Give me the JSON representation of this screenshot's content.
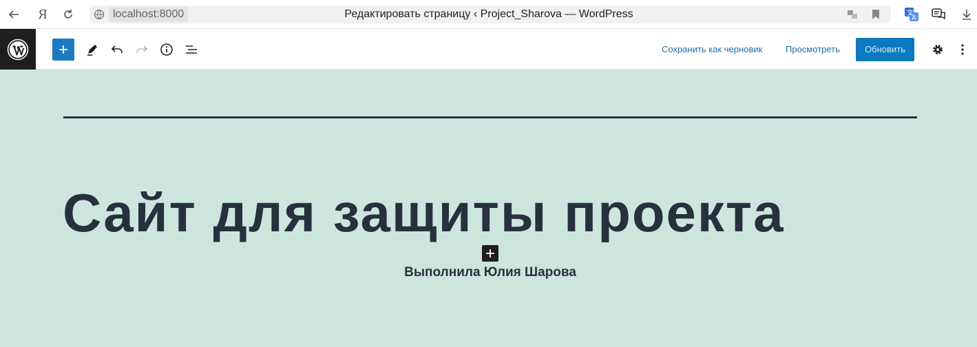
{
  "browser": {
    "url": "localhost:8000",
    "tab_title": "Редактировать страницу ‹ Project_Sharova — WordPress"
  },
  "toolbar": {
    "save_draft_label": "Сохранить как черновик",
    "preview_label": "Просмотреть",
    "update_label": "Обновить"
  },
  "content": {
    "title": "Сайт для защиты проекта",
    "author_line": "Выполнила Юлия Шарова"
  },
  "colors": {
    "canvas_bg": "#cce6de",
    "text_dark": "#28303d",
    "accent_blue": "#0a79bf"
  },
  "icons": [
    "back-icon",
    "yandex-icon",
    "reload-icon",
    "site-info-icon",
    "incognito-icon",
    "bookmark-icon",
    "translate-icon",
    "chat-icon",
    "download-icon",
    "wordpress-icon",
    "plus-icon",
    "pencil-icon",
    "undo-icon",
    "redo-icon",
    "info-icon",
    "list-view-icon",
    "gear-icon",
    "kebab-icon"
  ]
}
